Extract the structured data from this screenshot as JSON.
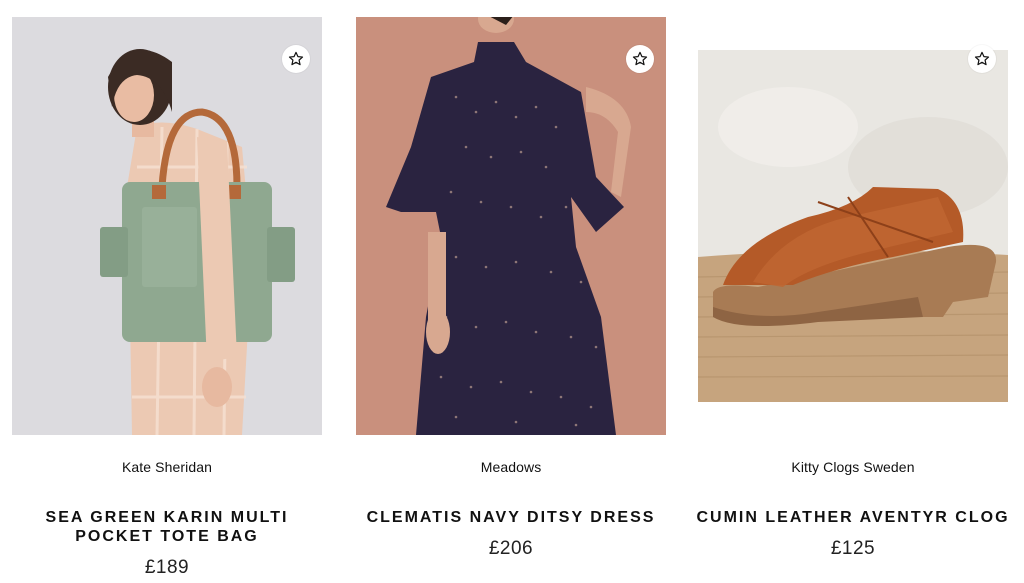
{
  "products": [
    {
      "brand": "Kate Sheridan",
      "title_line1": "SEA GREEN KARIN MULTI",
      "title_line2": "POCKET TOTE BAG",
      "price": "£189",
      "favorite_icon": "star-outline-icon",
      "image_desc_colors": {
        "bg": "#d9d8dc",
        "bag": "#8fa890",
        "strap": "#b4693a",
        "coat": "#e8c8b4"
      }
    },
    {
      "brand": "Meadows",
      "title_line1": "CLEMATIS NAVY DITSY DRESS",
      "title_line2": "",
      "price": "£206",
      "favorite_icon": "star-outline-icon",
      "image_desc_colors": {
        "bg": "#c9907d",
        "dress": "#2a2340"
      }
    },
    {
      "brand": "Kitty Clogs Sweden",
      "title_line1": "CUMIN LEATHER AVENTYR CLOG",
      "title_line2": "",
      "price": "£125",
      "favorite_icon": "star-outline-icon",
      "image_desc_colors": {
        "wall": "#e6e4df",
        "mat": "#c4a27c",
        "leather": "#b45a28",
        "wood": "#a87b54"
      }
    }
  ]
}
